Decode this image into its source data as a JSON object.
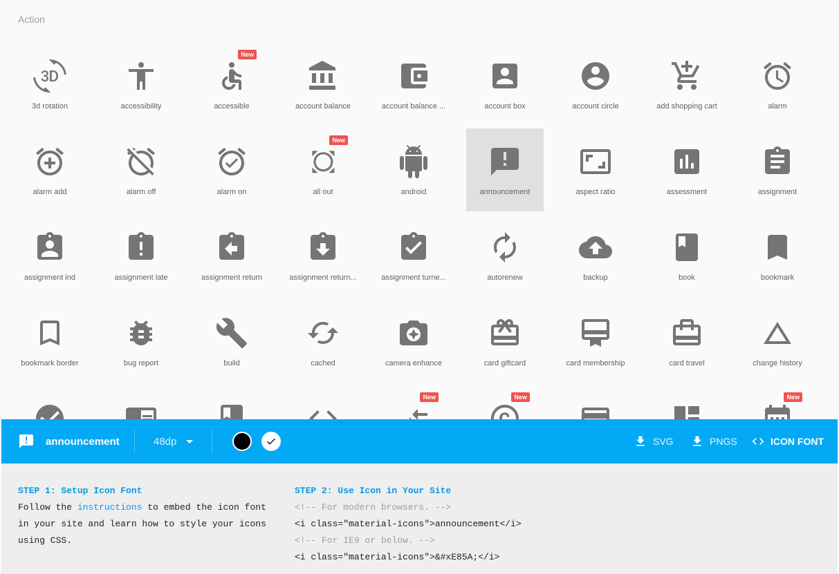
{
  "section": {
    "title": "Action"
  },
  "icons": [
    {
      "name": "3d rotation",
      "icon": "3d-rotation-icon",
      "new": false
    },
    {
      "name": "accessibility",
      "icon": "accessibility-icon",
      "new": false
    },
    {
      "name": "accessible",
      "icon": "accessible-icon",
      "new": true
    },
    {
      "name": "account balance",
      "icon": "account-balance-icon",
      "new": false
    },
    {
      "name": "account balance ...",
      "icon": "account-balance-wallet-icon",
      "new": false
    },
    {
      "name": "account box",
      "icon": "account-box-icon",
      "new": false
    },
    {
      "name": "account circle",
      "icon": "account-circle-icon",
      "new": false
    },
    {
      "name": "add shopping cart",
      "icon": "add-shopping-cart-icon",
      "new": false
    },
    {
      "name": "alarm",
      "icon": "alarm-icon",
      "new": false
    },
    {
      "name": "alarm add",
      "icon": "alarm-add-icon",
      "new": false
    },
    {
      "name": "alarm off",
      "icon": "alarm-off-icon",
      "new": false
    },
    {
      "name": "alarm on",
      "icon": "alarm-on-icon",
      "new": false
    },
    {
      "name": "all out",
      "icon": "all-out-icon",
      "new": true
    },
    {
      "name": "android",
      "icon": "android-icon",
      "new": false
    },
    {
      "name": "announcement",
      "icon": "announcement-icon",
      "new": false,
      "selected": true
    },
    {
      "name": "aspect ratio",
      "icon": "aspect-ratio-icon",
      "new": false
    },
    {
      "name": "assessment",
      "icon": "assessment-icon",
      "new": false
    },
    {
      "name": "assignment",
      "icon": "assignment-icon",
      "new": false
    },
    {
      "name": "assignment ind",
      "icon": "assignment-ind-icon",
      "new": false
    },
    {
      "name": "assignment late",
      "icon": "assignment-late-icon",
      "new": false
    },
    {
      "name": "assignment return",
      "icon": "assignment-return-icon",
      "new": false
    },
    {
      "name": "assignment return...",
      "icon": "assignment-returned-icon",
      "new": false
    },
    {
      "name": "assignment turne...",
      "icon": "assignment-turned-in-icon",
      "new": false
    },
    {
      "name": "autorenew",
      "icon": "autorenew-icon",
      "new": false
    },
    {
      "name": "backup",
      "icon": "backup-icon",
      "new": false
    },
    {
      "name": "book",
      "icon": "book-icon",
      "new": false
    },
    {
      "name": "bookmark",
      "icon": "bookmark-icon",
      "new": false
    },
    {
      "name": "bookmark border",
      "icon": "bookmark-border-icon",
      "new": false
    },
    {
      "name": "bug report",
      "icon": "bug-report-icon",
      "new": false
    },
    {
      "name": "build",
      "icon": "build-icon",
      "new": false
    },
    {
      "name": "cached",
      "icon": "cached-icon",
      "new": false
    },
    {
      "name": "camera enhance",
      "icon": "camera-enhance-icon",
      "new": false
    },
    {
      "name": "card giftcard",
      "icon": "card-giftcard-icon",
      "new": false
    },
    {
      "name": "card membership",
      "icon": "card-membership-icon",
      "new": false
    },
    {
      "name": "card travel",
      "icon": "card-travel-icon",
      "new": false
    },
    {
      "name": "change history",
      "icon": "change-history-icon",
      "new": false
    },
    {
      "name": "",
      "icon": "check-circle-icon",
      "new": false
    },
    {
      "name": "",
      "icon": "chrome-reader-mode-icon",
      "new": false
    },
    {
      "name": "",
      "icon": "class-icon",
      "new": false
    },
    {
      "name": "",
      "icon": "code-icon",
      "new": false
    },
    {
      "name": "",
      "icon": "compare-arrows-icon",
      "new": true
    },
    {
      "name": "",
      "icon": "copyright-icon",
      "new": true
    },
    {
      "name": "",
      "icon": "credit-card-icon",
      "new": false
    },
    {
      "name": "",
      "icon": "dashboard-icon",
      "new": false
    },
    {
      "name": "",
      "icon": "date-range-icon",
      "new": true
    }
  ],
  "badge_label": "New",
  "toolbar": {
    "icon_name": "announcement",
    "size": "48dp",
    "download_svg": "SVG",
    "download_pngs": "PNGS",
    "icon_font": "ICON FONT",
    "bg_color": "#03a9f4"
  },
  "code": {
    "step1_title": "STEP 1: Setup Icon Font",
    "step1_line1_a": "Follow the ",
    "step1_link": "instructions",
    "step1_line1_b": " to embed the icon font",
    "step1_line2": "in your site and learn how to style your icons",
    "step1_line3": "using CSS.",
    "step2_title": "STEP 2: Use Icon in Your Site",
    "comment1": "<!-- For modern browsers. -->",
    "code1": "<i class=\"material-icons\">announcement</i>",
    "comment2": "<!-- For IE9 or below. -->",
    "code2": "<i class=\"material-icons\">&#xE85A;</i>"
  }
}
